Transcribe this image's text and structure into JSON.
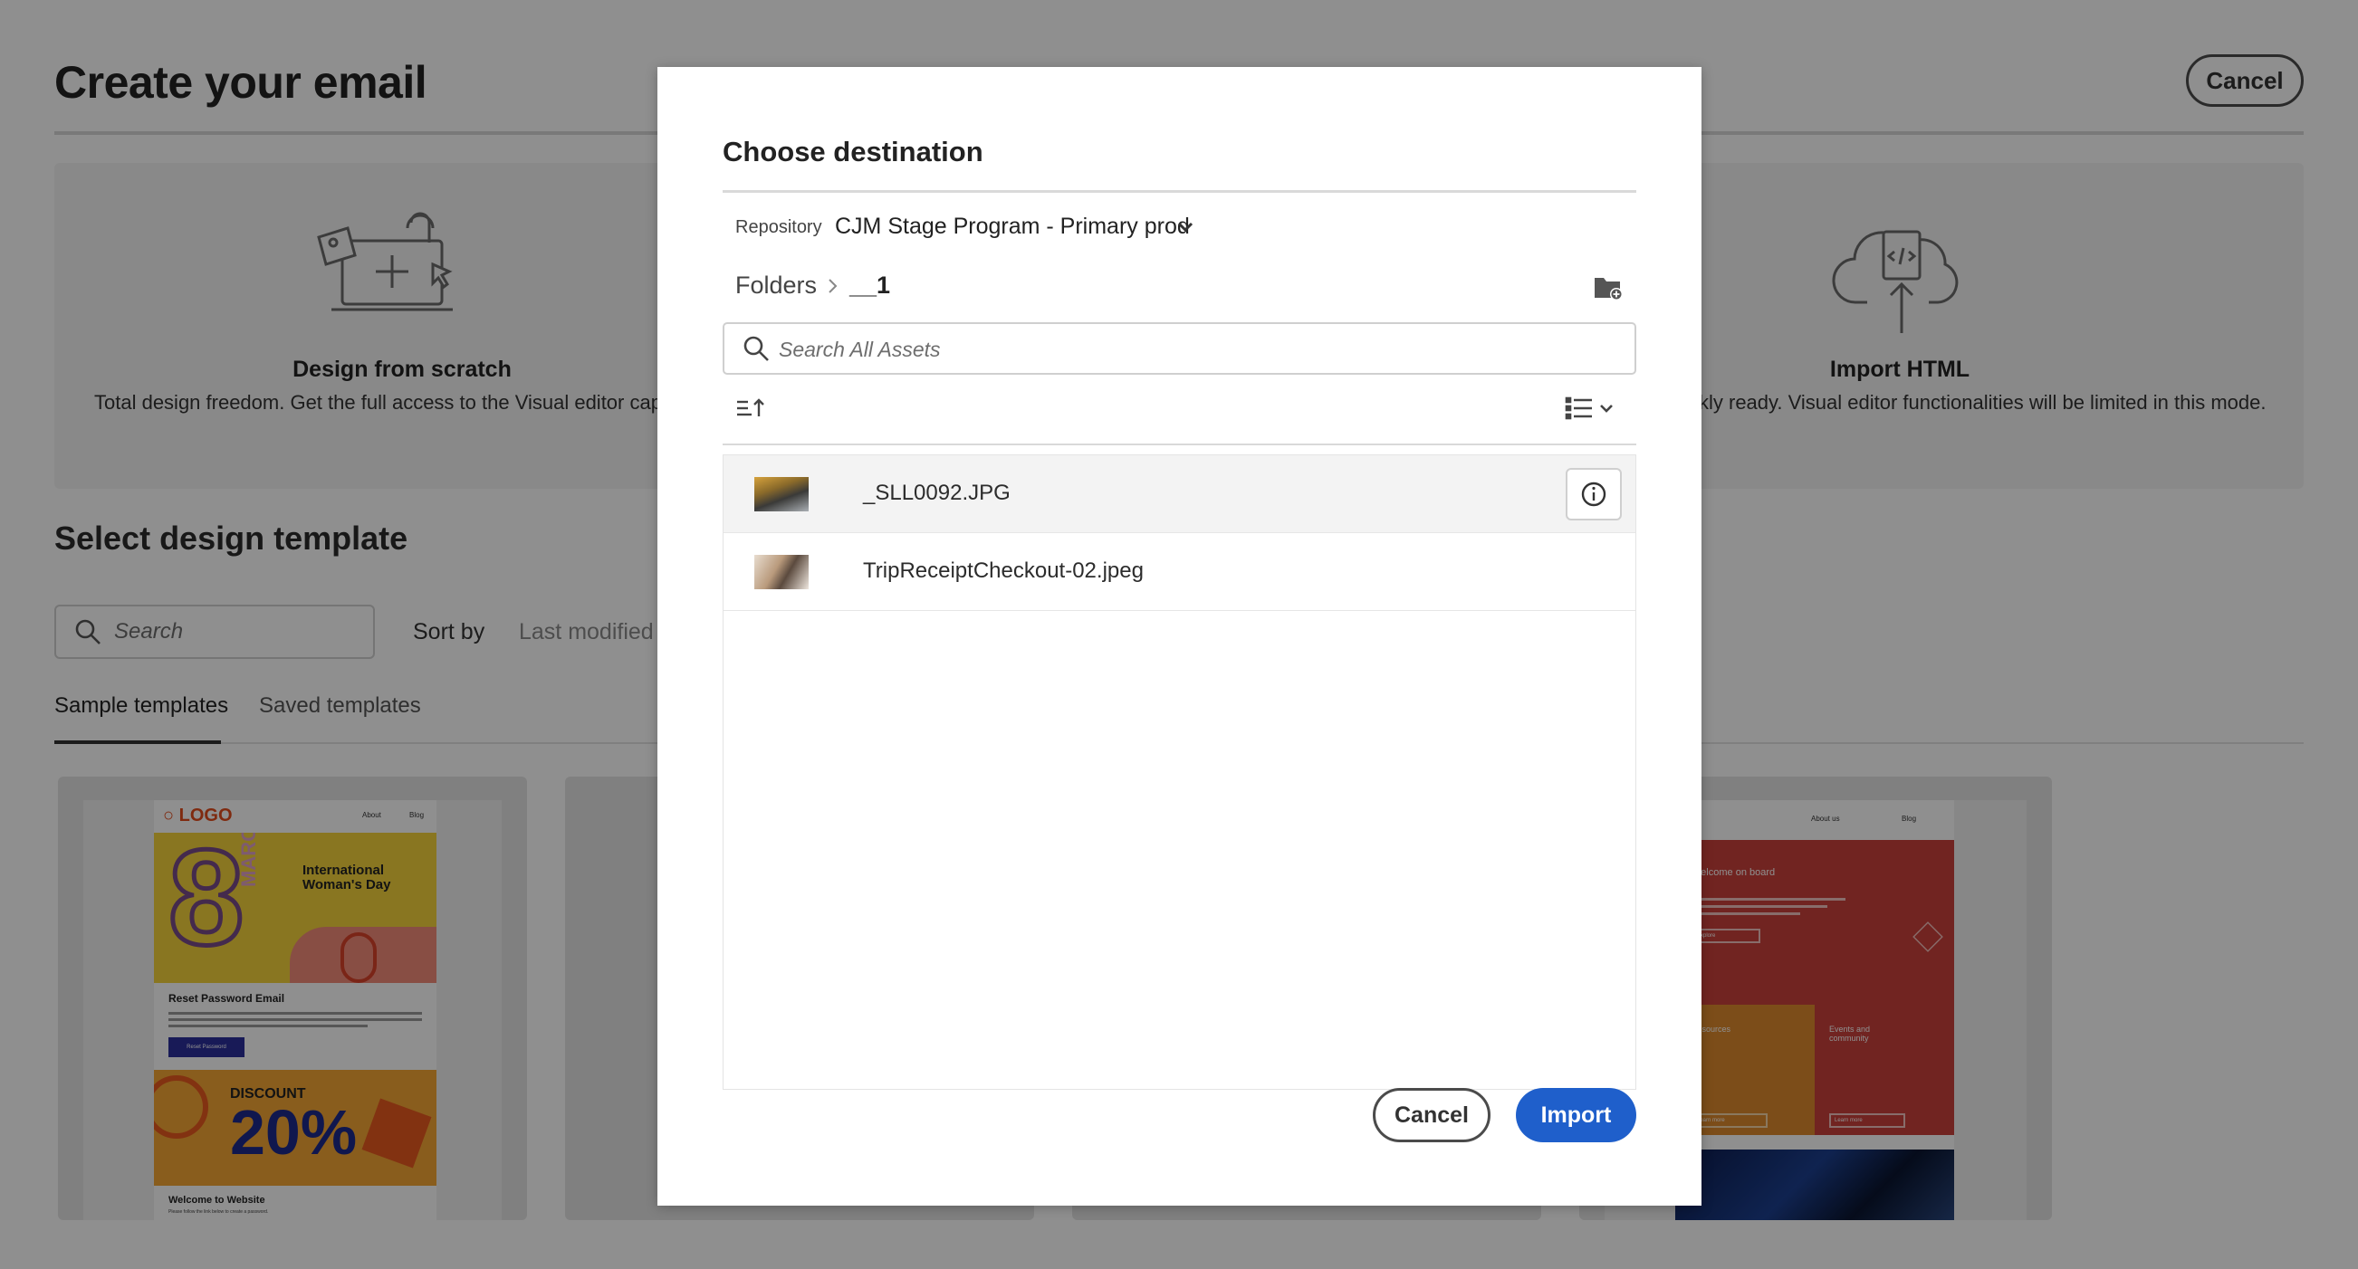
{
  "page": {
    "title": "Create your email",
    "cancel_label": "Cancel",
    "options": [
      {
        "icon": "design-canvas-icon",
        "title": "Design from scratch",
        "description": "Total design freedom. Get the full access to the Visual editor capab"
      },
      {
        "icon": "cloud-upload-code-icon",
        "title": "Import HTML",
        "description": "kly ready. Visual editor functionalities will be limited in this mode."
      }
    ],
    "template_section_title": "Select design template",
    "search_placeholder": "Search",
    "sort_by_label": "Sort by",
    "sort_by_value": "Last modified",
    "tabs": [
      {
        "label": "Sample templates",
        "active": true
      },
      {
        "label": "Saved templates",
        "active": false
      }
    ],
    "template_previews": {
      "logo_text": "LOGO",
      "nav": [
        "About",
        "Blog"
      ],
      "womens_day": "International Woman's Day",
      "march": "MARCH",
      "big_number": "8",
      "reset_heading": "Reset Password Email",
      "reset_button": "Reset Password",
      "discount_label": "DISCOUNT",
      "discount_value": "20%",
      "welcome_heading": "Welcome to Website",
      "welcome_text": "Please follow the link below to create a password.",
      "right_nav": [
        "About us",
        "Blog"
      ],
      "welcome_board": "Welcome on board",
      "explore": "Explore",
      "resources": "Resources",
      "events": "Events and community",
      "learn_more": "Learn more"
    }
  },
  "modal": {
    "title": "Choose destination",
    "repository_label": "Repository",
    "repository_value": "CJM Stage Program - Primary prod",
    "breadcrumb": {
      "root": "Folders",
      "current": "__1"
    },
    "search_placeholder": "Search All Assets",
    "files": [
      {
        "name": "_SLL0092.JPG",
        "selected": true
      },
      {
        "name": "TripReceiptCheckout-02.jpeg",
        "selected": false
      }
    ],
    "cancel_label": "Cancel",
    "import_label": "Import"
  },
  "colors": {
    "accent": "#1f5fcb",
    "overlay": "rgba(0,0,0,0.44)"
  }
}
